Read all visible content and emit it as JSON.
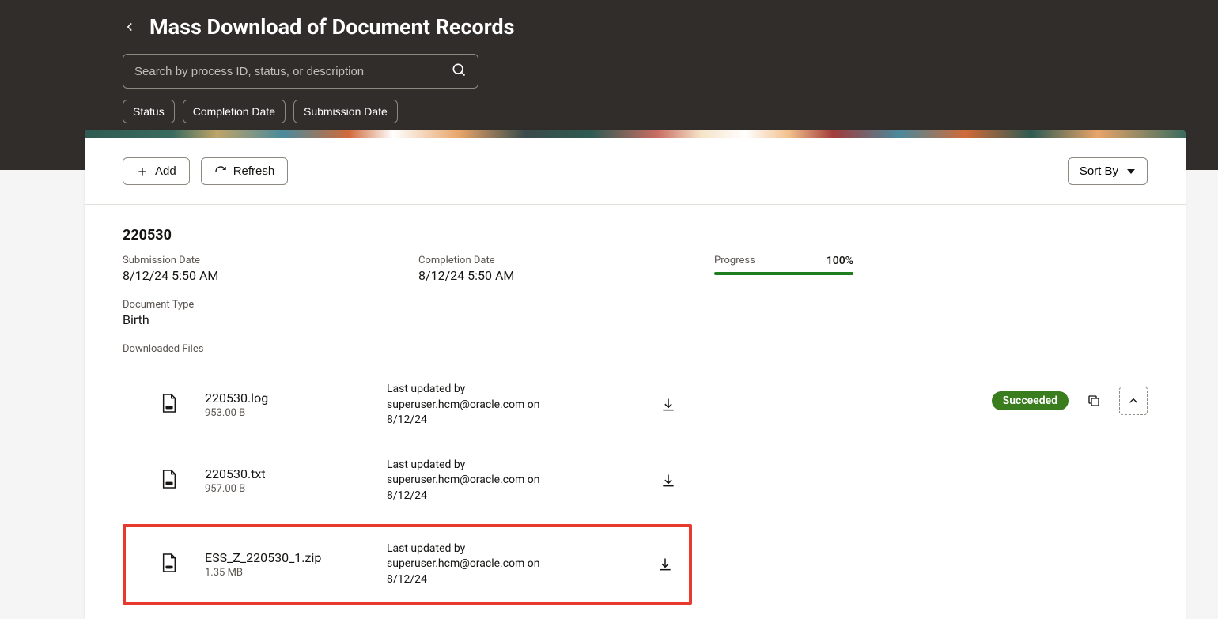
{
  "header": {
    "title": "Mass Download of Document Records",
    "search_placeholder": "Search by process ID, status, or description",
    "filters": [
      "Status",
      "Completion Date",
      "Submission Date"
    ]
  },
  "toolbar": {
    "add_label": "Add",
    "refresh_label": "Refresh",
    "sort_label": "Sort By"
  },
  "record": {
    "id": "220530",
    "submission_date_label": "Submission Date",
    "submission_date": "8/12/24 5:50 AM",
    "completion_date_label": "Completion Date",
    "completion_date": "8/12/24 5:50 AM",
    "progress_label": "Progress",
    "progress_pct": "100%",
    "document_type_label": "Document Type",
    "document_type": "Birth",
    "files_label": "Downloaded Files",
    "status": "Succeeded",
    "files": [
      {
        "name": "220530.log",
        "size": "953.00 B",
        "updated": "Last updated by superuser.hcm@oracle.com on 8/12/24",
        "type": "doc"
      },
      {
        "name": "220530.txt",
        "size": "957.00 B",
        "updated": "Last updated by superuser.hcm@oracle.com on 8/12/24",
        "type": "doc"
      },
      {
        "name": "ESS_Z_220530_1.zip",
        "size": "1.35 MB",
        "updated": "Last updated by superuser.hcm@oracle.com on 8/12/24",
        "type": "zip"
      }
    ]
  }
}
